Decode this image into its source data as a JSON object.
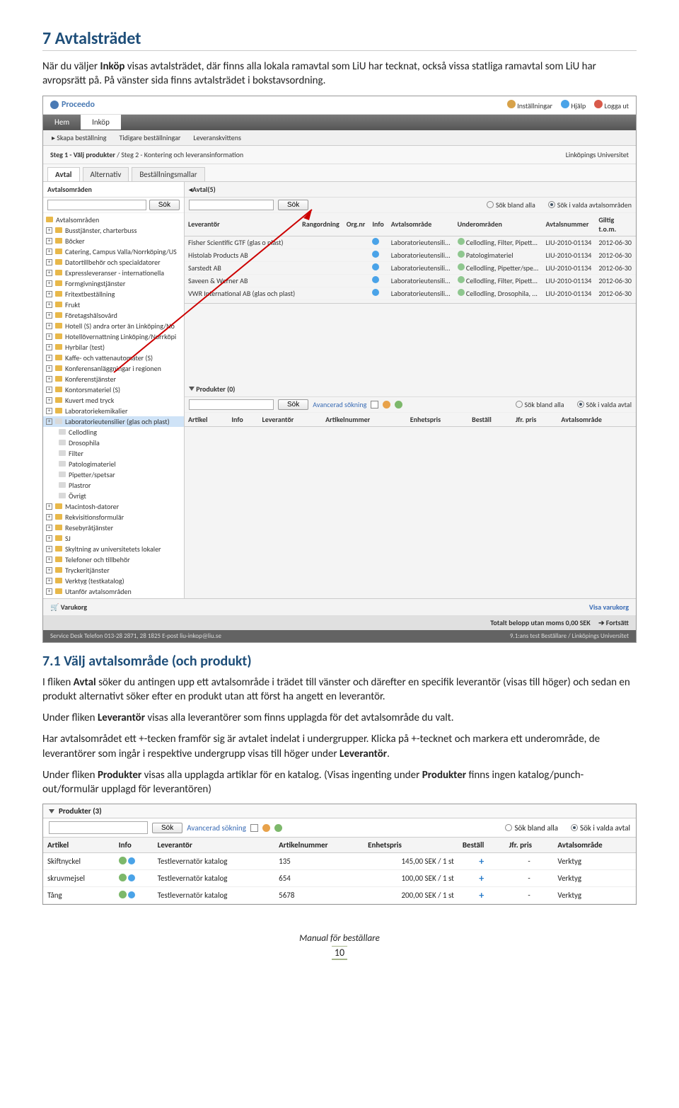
{
  "doc": {
    "h1": "7 Avtalsträdet",
    "p1a": "När du väljer ",
    "p1b": "Inköp",
    "p1c": " visas avtalsträdet, där finns alla lokala ramavtal som LiU har tecknat, också vissa statliga ramavtal som LiU har avropsrätt på. På vänster sida finns avtalsträdet i bokstavsordning.",
    "h2": "7.1 Välj avtalsområde (och produkt)",
    "p2a": "I fliken ",
    "p2b": "Avtal",
    "p2c": " söker du antingen upp ett avtalsområde i trädet till vänster och därefter en specifik leverantör (visas till höger) och sedan en produkt alternativt söker efter en produkt utan att först ha angett en leverantör.",
    "p3a": "Under fliken ",
    "p3b": "Leverantör",
    "p3c": " visas alla leverantörer som finns upplagda för det avtalsområde du valt.",
    "p4": "Har avtalsområdet ett +-tecken framför sig är avtalet indelat i undergrupper. Klicka på +-tecknet och markera ett underområde, de leverantörer som ingår i respektive undergrupp visas till höger under ",
    "p4b": "Leverantör",
    "p4c": ".",
    "p5a": "Under fliken ",
    "p5b": "Produkter",
    "p5c": " visas alla upplagda artiklar för en katalog. (Visas ingenting under ",
    "p5d": "Produkter",
    "p5e": " finns ingen katalog/punch-out/formulär upplagd för leverantören)",
    "footer": "Manual för beställare",
    "pagenum": "10"
  },
  "app": {
    "brand": "Proceedo",
    "top": {
      "settings": "Inställningar",
      "help": "Hjälp",
      "logout": "Logga ut"
    },
    "tabs": {
      "home": "Hem",
      "inkop": "Inköp"
    },
    "sub": {
      "skapa": "Skapa beställning",
      "tidigare": "Tidigare beställningar",
      "lever": "Leveranskvittens"
    },
    "step": {
      "s1": "Steg 1 - Välj produkter",
      "sep": " / ",
      "s2": "Steg 2 - Kontering och leveransinformation",
      "org": "Linköpings Universitet"
    },
    "sectabs": {
      "avtal": "Avtal",
      "alt": "Alternativ",
      "best": "Beställningsmallar"
    },
    "tree": {
      "head": "Avtalsområden",
      "sok": "Sök",
      "items": [
        "Avtalsområden",
        "Busstjänster, charterbuss",
        "Böcker",
        "Catering, Campus Valla/Norrköping/US",
        "Datortillbehör och specialdatorer",
        "Expressleveranser - internationella",
        "Formgivningstjänster",
        "Fritextbeställning",
        "Frukt",
        "Företagshälsovård",
        "Hotell (S) andra orter än Linköping/No",
        "Hotellövernattning Linköping/Norrköpi",
        "Hyrbilar (test)",
        "Kaffe- och vattenautomater (S)",
        "Konferensanläggningar i regionen",
        "Konferenstjänster",
        "Kontorsmateriel (S)",
        "Kuvert med tryck",
        "Laboratoriekemikalier",
        "Laboratorieutensilier (glas och plast)"
      ],
      "sub": [
        "Cellodling",
        "Drosophila",
        "Filter",
        "Patologimateriel",
        "Pipetter/spetsar",
        "Plastror",
        "Övrigt"
      ],
      "items2": [
        "Macintosh-datorer",
        "Rekvisitionsformulär",
        "Resebyråtjänster",
        "SJ",
        "Skyltning av universitetets lokaler",
        "Telefoner och tillbehör",
        "Tryckeritjänster",
        "Verktyg (testkatalog)",
        "Utanför avtalsområden"
      ]
    },
    "sup": {
      "head": "Avtal(5)",
      "sok": "Sök",
      "r1": "Sök bland alla",
      "r2": "Sök i valda avtalsområden",
      "cols": [
        "Leverantör",
        "Rangordning",
        "Org.nr",
        "Info",
        "Avtalsområde",
        "Underområden",
        "Avtalsnummer",
        "Giltig t.o.m."
      ],
      "rows": [
        [
          "Fisher Scientific GTF (glas o plast)",
          "",
          "",
          "Laboratorieutensili...",
          "Cellodling, Filter, Pipett...",
          "LIU-2010-01134",
          "2012-06-30"
        ],
        [
          "Histolab Products AB",
          "",
          "",
          "Laboratorieutensili...",
          "Patologimateriel",
          "LIU-2010-01134",
          "2012-06-30"
        ],
        [
          "Sarstedt AB",
          "",
          "",
          "Laboratorieutensili...",
          "Cellodling, Pipetter/spe...",
          "LIU-2010-01134",
          "2012-06-30"
        ],
        [
          "Saveen & Werner AB",
          "",
          "",
          "Laboratorieutensili...",
          "Cellodling, Filter, Pipett...",
          "LIU-2010-01134",
          "2012-06-30"
        ],
        [
          "VWR International AB (glas och plast)",
          "",
          "",
          "Laboratorieutensili...",
          "Cellodling, Drosophila, ...",
          "LIU-2010-01134",
          "2012-06-30"
        ]
      ]
    },
    "prod": {
      "head": "Produkter (0)",
      "sok": "Sök",
      "adv": "Avancerad sökning",
      "r1": "Sök bland alla",
      "r2": "Sök i valda avtal",
      "cols": [
        "Artikel",
        "Info",
        "Leverantör",
        "Artikelnummer",
        "Enhetspris",
        "Beställ",
        "Jfr. pris",
        "Avtalsområde"
      ]
    },
    "cart": "Varukorg",
    "show": "Visa varukorg",
    "total": "Totalt belopp utan moms  0,00 SEK",
    "cont": "Fortsätt",
    "footL": "Service Desk Telefon 013-28 2871, 28 1825  E-post liu-inkop@liu.se",
    "footR": "9.1:ans test Beställare / Linköpings Universitet"
  },
  "s2": {
    "head": "Produkter (3)",
    "sok": "Sök",
    "adv": "Avancerad sökning",
    "r1": "Sök bland alla",
    "r2": "Sök i valda avtal",
    "cols": [
      "Artikel",
      "Info",
      "Leverantör",
      "Artikelnummer",
      "Enhetspris",
      "Beställ",
      "Jfr. pris",
      "Avtalsområde"
    ],
    "rows": [
      [
        "Skiftnyckel",
        "Testlevernatör katalog",
        "135",
        "145,00 SEK / 1 st",
        "-",
        "Verktyg"
      ],
      [
        "skruvmejsel",
        "Testlevernatör katalog",
        "654",
        "100,00 SEK / 1 st",
        "-",
        "Verktyg"
      ],
      [
        "Tång",
        "Testlevernatör katalog",
        "5678",
        "200,00 SEK / 1 st",
        "-",
        "Verktyg"
      ]
    ]
  }
}
